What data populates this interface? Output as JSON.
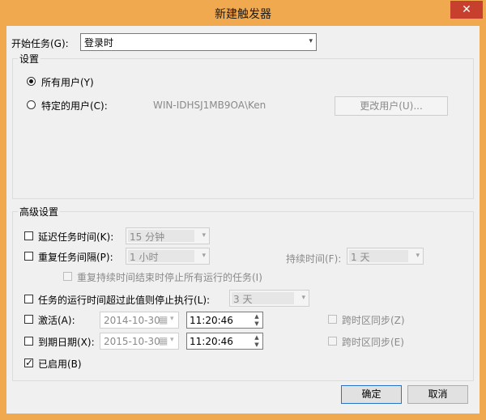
{
  "window": {
    "title": "新建触发器",
    "close_glyph": "✕"
  },
  "start_task": {
    "label": "开始任务(G):",
    "value": "登录时"
  },
  "settings": {
    "title": "设置",
    "all_users_label": "所有用户(Y)",
    "specific_user_label": "特定的用户(C):",
    "user_name": "WIN-IDHSJ1MB9OA\\Ken",
    "change_user_button": "更改用户(U)..."
  },
  "advanced": {
    "title": "高级设置",
    "delay_label": "延迟任务时间(K):",
    "delay_value": "15 分钟",
    "repeat_label": "重复任务间隔(P):",
    "repeat_value": "1 小时",
    "duration_label": "持续时间(F):",
    "duration_value": "1 天",
    "stop_running_label": "重复持续时间结束时停止所有运行的任务(I)",
    "stop_if_longer_label": "任务的运行时间超过此值则停止执行(L):",
    "stop_if_longer_value": "3 天",
    "activate_label": "激活(A):",
    "activate_date": "2014-10-30",
    "activate_time": "11:20:46",
    "sync_tz_label_1": "跨时区同步(Z)",
    "expire_label": "到期日期(X):",
    "expire_date": "2015-10-30",
    "expire_time": "11:20:46",
    "sync_tz_label_2": "跨时区同步(E)",
    "enabled_label": "已启用(B)"
  },
  "buttons": {
    "ok": "确定",
    "cancel": "取消"
  },
  "icons": {
    "dropdown": "▾",
    "spin_up": "▲",
    "spin_down": "▼",
    "calendar": "▦"
  },
  "colors": {
    "frame": "#f0a94f",
    "close": "#c7402e",
    "client": "#f0f0f0",
    "default_button_border": "#2b73c9"
  }
}
